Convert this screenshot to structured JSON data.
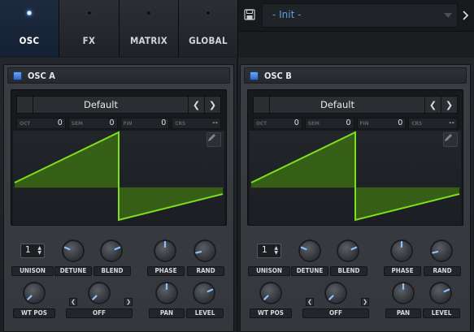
{
  "tabs": [
    {
      "label": "OSC",
      "active": true
    },
    {
      "label": "FX",
      "active": false
    },
    {
      "label": "MATRIX",
      "active": false
    },
    {
      "label": "GLOBAL",
      "active": false
    }
  ],
  "preset": {
    "name": "- Init -",
    "save_icon": "floppy-disk-icon",
    "dropdown_icon": "triangle-down-icon",
    "next_icon": "chevron-right-icon"
  },
  "oscillators": [
    {
      "title": "OSC A",
      "wavetable": "Default",
      "params": [
        {
          "name": "OCT",
          "value": "0"
        },
        {
          "name": "SEM",
          "value": "0"
        },
        {
          "name": "FIN",
          "value": "0"
        },
        {
          "name": "CRS",
          "value": "--"
        }
      ],
      "unison": "1",
      "knob_labels": {
        "detune": "DETUNE",
        "blend": "BLEND",
        "phase": "PHASE",
        "rand": "RAND",
        "wt_pos": "WT POS",
        "warp": "OFF",
        "pan": "PAN",
        "level": "LEVEL"
      },
      "unison_label": "UNISON",
      "knob_values": {
        "detune": 0.25,
        "blend": 0.75,
        "phase": 0.5,
        "rand": 0.12,
        "wt_pos": 0.0,
        "warp": 0.0,
        "pan": 0.5,
        "level": 0.75
      }
    },
    {
      "title": "OSC B",
      "wavetable": "Default",
      "params": [
        {
          "name": "OCT",
          "value": "0"
        },
        {
          "name": "SEM",
          "value": "0"
        },
        {
          "name": "FIN",
          "value": "0"
        },
        {
          "name": "CRS",
          "value": "--"
        }
      ],
      "unison": "1",
      "knob_labels": {
        "detune": "DETUNE",
        "blend": "BLEND",
        "phase": "PHASE",
        "rand": "RAND",
        "wt_pos": "WT POS",
        "warp": "OFF",
        "pan": "PAN",
        "level": "LEVEL"
      },
      "unison_label": "UNISON",
      "knob_values": {
        "detune": 0.25,
        "blend": 0.75,
        "phase": 0.5,
        "rand": 0.12,
        "wt_pos": 0.0,
        "warp": 0.0,
        "pan": 0.5,
        "level": 0.75
      }
    }
  ],
  "colors": {
    "accent": "#6aa8ff",
    "wave": "#7ddf1d",
    "wave_fill": "#3b6a14",
    "preset_text": "#5e9ee8"
  }
}
